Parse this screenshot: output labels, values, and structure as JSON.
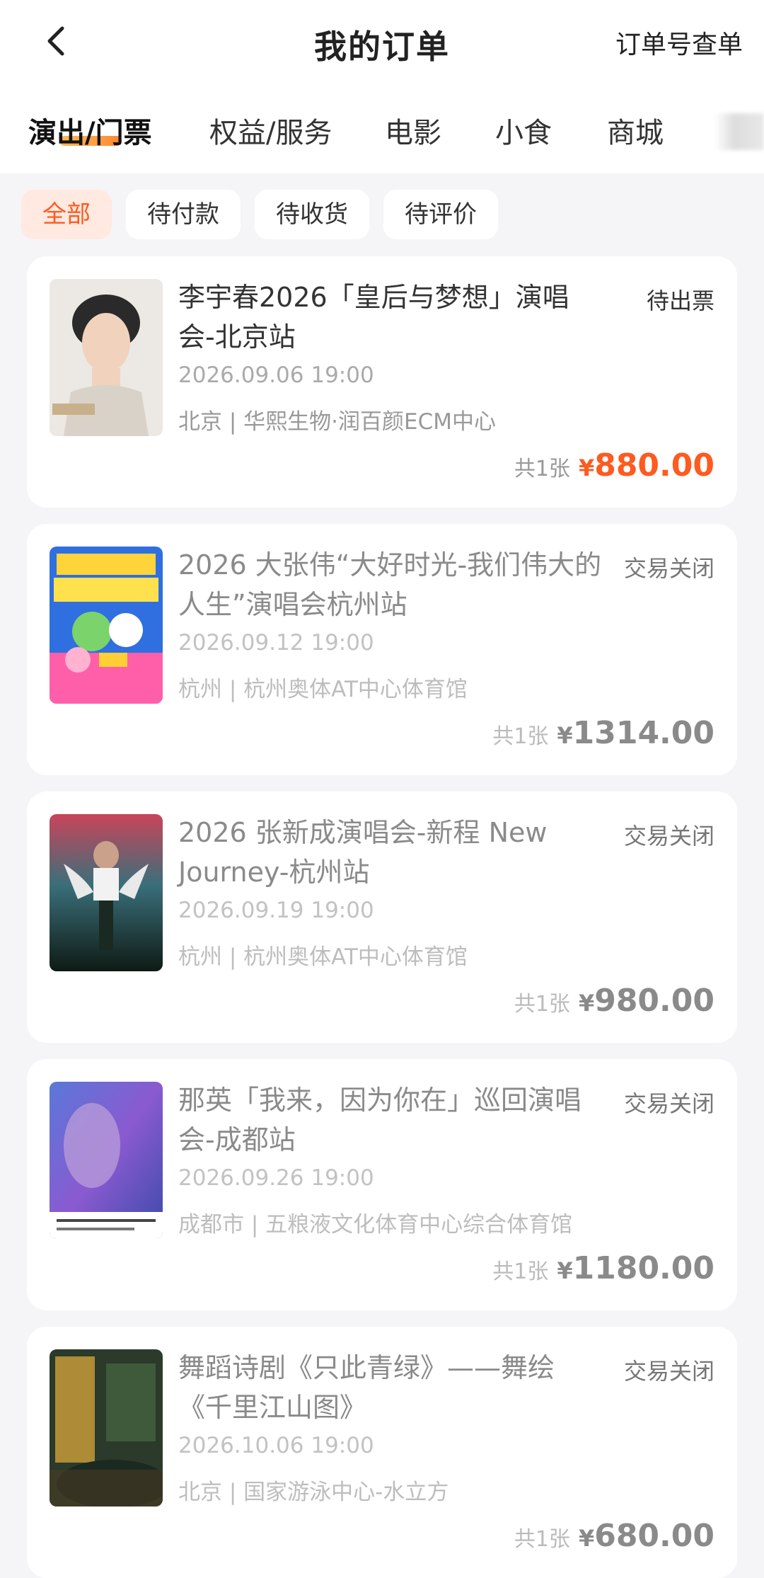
{
  "header": {
    "title": "我的订单",
    "order_lookup": "订单号查单"
  },
  "tabs": [
    {
      "label": "演出/门票"
    },
    {
      "label": "权益/服务"
    },
    {
      "label": "电影"
    },
    {
      "label": "小食"
    },
    {
      "label": "商城"
    }
  ],
  "filters": [
    {
      "label": "全部"
    },
    {
      "label": "待付款"
    },
    {
      "label": "待收货"
    },
    {
      "label": "待评价"
    }
  ],
  "orders": [
    {
      "title": "李宇春2026「皇后与梦想」演唱会-北京站",
      "status": "待出票",
      "datetime": "2026.09.06 19:00",
      "venue": "北京 | 华熙生物·润百颜ECM中心",
      "qty": "共1张",
      "currency": "¥",
      "price": "880.00"
    },
    {
      "title": "2026 大张伟“大好时光-我们伟大的人生”演唱会杭州站",
      "status": "交易关闭",
      "datetime": "2026.09.12 19:00",
      "venue": "杭州 | 杭州奥体AT中心体育馆",
      "qty": "共1张",
      "currency": "¥",
      "price": "1314.00"
    },
    {
      "title": "2026 张新成演唱会-新程 New Journey-杭州站",
      "status": "交易关闭",
      "datetime": "2026.09.19 19:00",
      "venue": "杭州 | 杭州奥体AT中心体育馆",
      "qty": "共1张",
      "currency": "¥",
      "price": "980.00"
    },
    {
      "title": "那英「我来，因为你在」巡回演唱会-成都站",
      "status": "交易关闭",
      "datetime": "2026.09.26 19:00",
      "venue": "成都市 | 五粮液文化体育中心综合体育馆",
      "qty": "共1张",
      "currency": "¥",
      "price": "1180.00"
    },
    {
      "title": "舞蹈诗剧《只此青绿》——舞绘《千里江山图》",
      "status": "交易关闭",
      "datetime": "2026.10.06 19:00",
      "venue": "北京 | 国家游泳中心-水立方",
      "qty": "共1张",
      "currency": "¥",
      "price": "680.00"
    }
  ]
}
